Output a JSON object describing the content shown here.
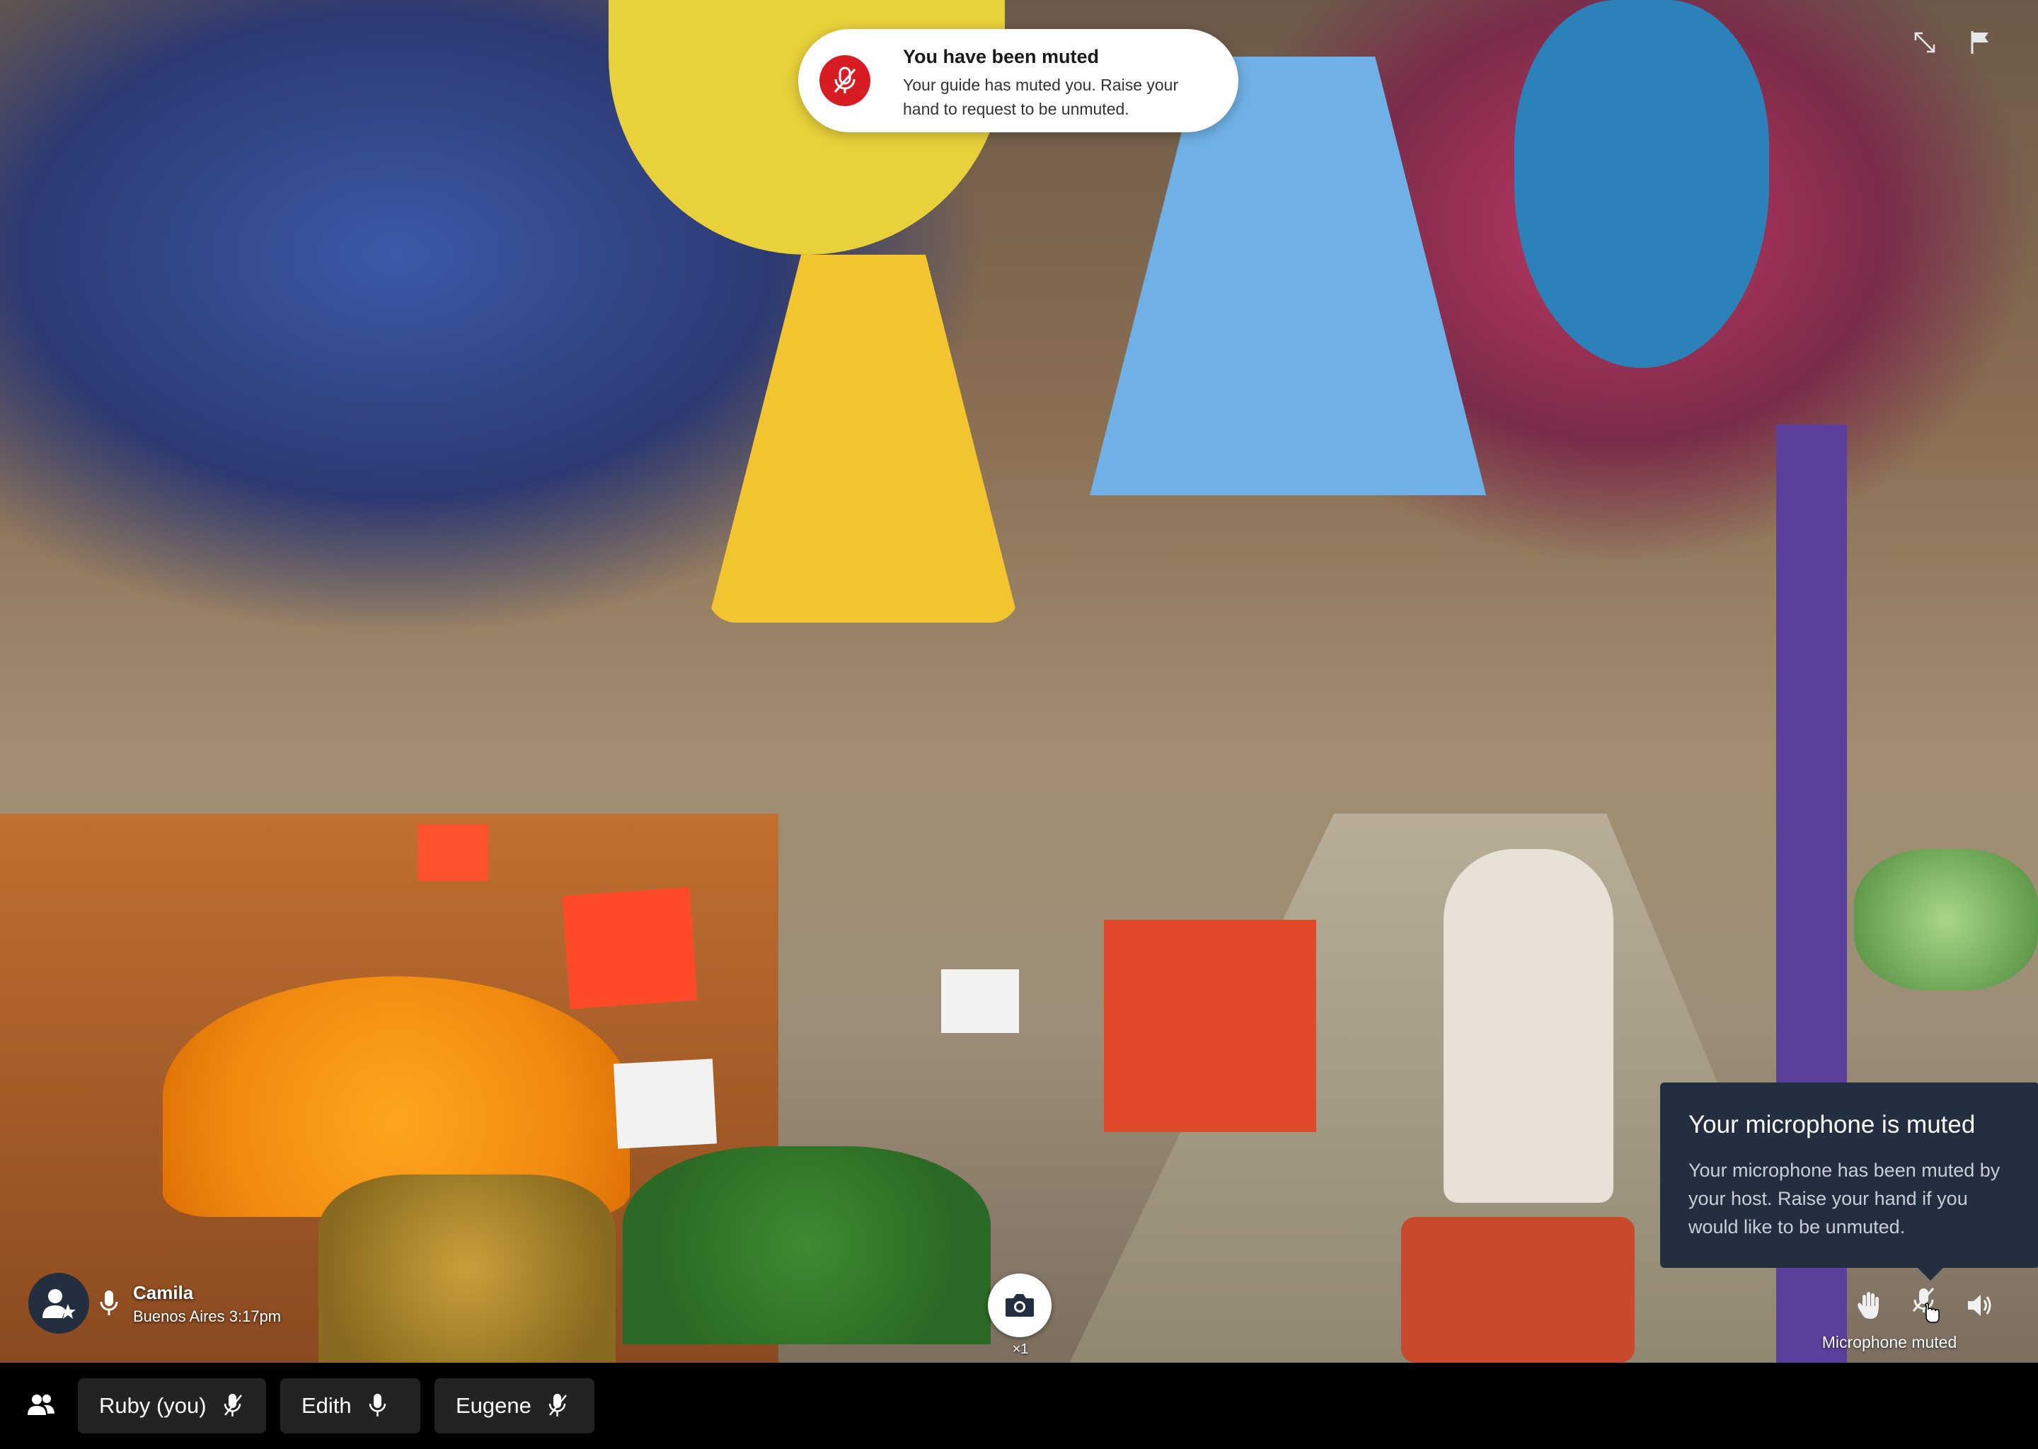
{
  "toast": {
    "title": "You have been muted",
    "body": "Your guide has muted you. Raise your hand to request to be unmuted.",
    "icon": "mic-off-icon"
  },
  "top_right": {
    "icons": [
      "expand-icon",
      "flag-icon"
    ]
  },
  "tooltip": {
    "title": "Your microphone is muted",
    "body": "Your microphone has been muted by your host. Raise your hand if you would like to be unmuted."
  },
  "controls": {
    "icons": [
      "raise-hand-icon",
      "mic-off-icon",
      "speaker-icon"
    ],
    "caption": "Microphone muted"
  },
  "host": {
    "name": "Camila",
    "location_time": "Buenos Aires 3:17pm",
    "icon": "host-star-icon"
  },
  "camera": {
    "count": "×1",
    "icon": "camera-icon"
  },
  "participants": {
    "icon": "people-icon",
    "list": [
      {
        "name": "Ruby (you)",
        "mic": "muted"
      },
      {
        "name": "Edith",
        "mic": "on"
      },
      {
        "name": "Eugene",
        "mic": "muted"
      }
    ]
  },
  "colors": {
    "toast_icon_bg": "#d81c24",
    "tooltip_bg": "#232f3e",
    "bar_bg": "#000000",
    "chip_bg": "#232323"
  }
}
